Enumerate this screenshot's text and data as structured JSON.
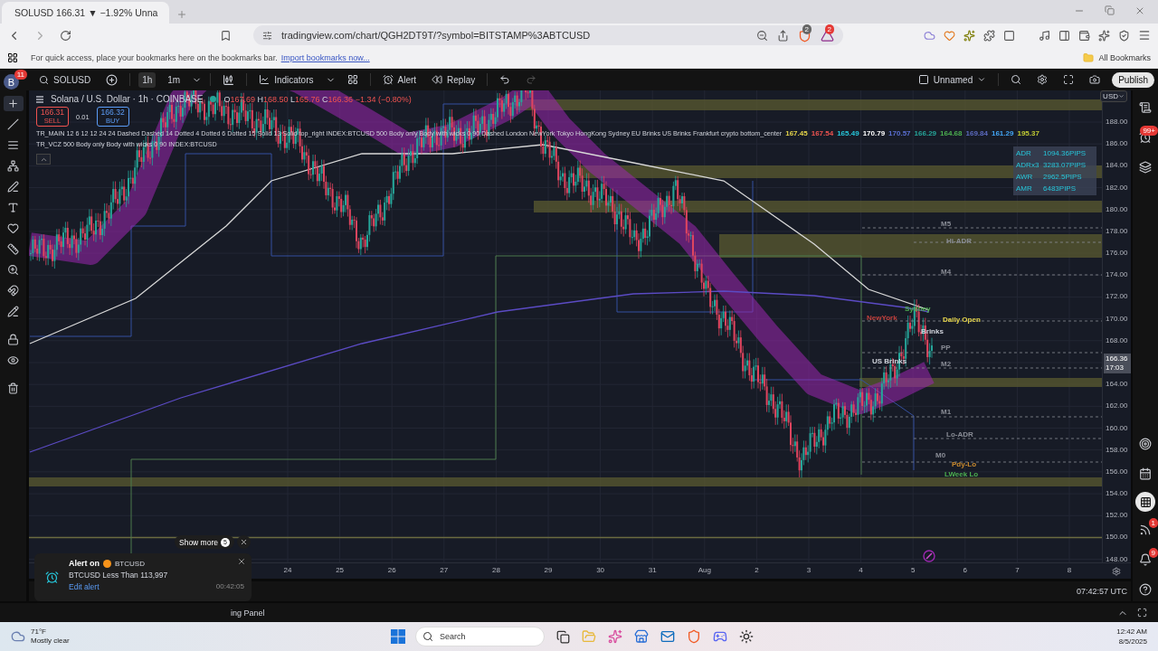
{
  "browser": {
    "tab_title": "SOLUSD 166.31 ▼ −1.92% Unna",
    "url": "tradingview.com/chart/QGH2DT9T/?symbol=BITSTAMP%3ABTCUSD",
    "extension_badges": [
      "2",
      "2"
    ],
    "bookmarks_hint": "For quick access, place your bookmarks here on the bookmarks bar.",
    "import_link": "Import bookmarks now...",
    "all_bookmarks": "All Bookmarks"
  },
  "toolbar": {
    "avatar": "B",
    "avatar_badge": "11",
    "symbol": "SOLUSD",
    "intervals": [
      {
        "label": "1h",
        "selected": true
      },
      {
        "label": "1m",
        "selected": false
      }
    ],
    "indicators": "Indicators",
    "alert": "Alert",
    "replay": "Replay",
    "layout_name": "Unnamed",
    "publish": "Publish"
  },
  "chart": {
    "title": "Solana / U.S. Dollar · 1h · COINBASE",
    "ohlc": [
      {
        "label": "O",
        "value": "167.69"
      },
      {
        "label": "H",
        "value": "168.50"
      },
      {
        "label": "L",
        "value": "165.76"
      },
      {
        "label": "C",
        "value": "166.36"
      }
    ],
    "change": "−1.34 (−0.80%)",
    "sell": {
      "price": "166.31",
      "label": "SELL"
    },
    "spread": "0.01",
    "buy": {
      "price": "166.32",
      "label": "BUY"
    },
    "indicator_lines": [
      {
        "text": "TR_MAIN 12 6 12 12 24 24 Dashed Dashed 14 Dotted 4 Dotted 6 Dotted 15 Solid 13 Solid top_right INDEX:BTCUSD 500 Body only Body with wicks 0 90 Dashed London NewYork Tokyo HongKong Sydney EU Brinks US Brinks Frankfurt crypto bottom_center",
        "values": [
          {
            "text": "167.45",
            "color": "#e6d54a"
          },
          {
            "text": "167.54",
            "color": "#ef5350"
          },
          {
            "text": "165.49",
            "color": "#26c6da"
          },
          {
            "text": "170.79",
            "color": "#ffffff"
          },
          {
            "text": "170.57",
            "color": "#5a6fd0"
          },
          {
            "text": "166.29",
            "color": "#26a69a"
          },
          {
            "text": "164.68",
            "color": "#4caf50"
          },
          {
            "text": "169.84",
            "color": "#5c6bc0"
          },
          {
            "text": "161.29",
            "color": "#42a5f5"
          },
          {
            "text": "195.37",
            "color": "#c0ca33"
          }
        ]
      },
      {
        "text": "TR_VCZ 500 Body only Body with wicks 0 90 INDEX:BTCUSD"
      }
    ],
    "adr_table": [
      {
        "label": "ADR",
        "value": "1094.36PIPS"
      },
      {
        "label": "ADRx3",
        "value": "3283.07PIPS"
      },
      {
        "label": "AWR",
        "value": "2962.5PIPS"
      },
      {
        "label": "AMR",
        "value": "6483PIPS"
      }
    ],
    "levels": [
      {
        "label": "M5",
        "color": "#8a8d96"
      },
      {
        "label": "Hi-ADR",
        "color": "#8a8d96"
      },
      {
        "label": "M4",
        "color": "#8a8d96"
      },
      {
        "label": "NewYork",
        "color": "#c2403d"
      },
      {
        "label": "Sydney",
        "color": "#4caf50"
      },
      {
        "label": "Daily Open",
        "color": "#e6d54a"
      },
      {
        "label": "Brinks",
        "color": "#d1d4dc"
      },
      {
        "label": "PP",
        "color": "#8a8d96"
      },
      {
        "label": "US Brinks",
        "color": "#d1d4dc"
      },
      {
        "label": "M2",
        "color": "#8a8d96"
      },
      {
        "label": "M1",
        "color": "#8a8d96"
      },
      {
        "label": "Lo-ADR",
        "color": "#8a8d96"
      },
      {
        "label": "M0",
        "color": "#8a8d96"
      },
      {
        "label": "Pdy-Lo",
        "color": "#c98a2e"
      },
      {
        "label": "LWeek Lo",
        "color": "#4caf50"
      }
    ]
  },
  "price_axis": {
    "currency": "USD",
    "labels": [
      "188.00",
      "186.00",
      "184.00",
      "182.00",
      "180.00",
      "178.00",
      "176.00",
      "174.00",
      "172.00",
      "170.00",
      "168.00",
      "164.00",
      "162.00",
      "160.00",
      "158.00",
      "156.00",
      "154.00",
      "152.00",
      "150.00",
      "148.00"
    ],
    "last_price": "166.36",
    "countdown": "17:03"
  },
  "time_axis": [
    "24",
    "25",
    "26",
    "27",
    "28",
    "29",
    "30",
    "31",
    "Aug",
    "2",
    "3",
    "4",
    "5",
    "6",
    "7",
    "8"
  ],
  "clock": "07:42:57 UTC",
  "sidebar_badges": {
    "alerts": "99+",
    "feed": "1",
    "notifications": "9"
  },
  "alert_popup": {
    "show_more": "Show more",
    "count": "5",
    "title": "Alert on",
    "symbol": "BTCUSD",
    "message": "BTCUSD Less Than 113,997",
    "edit_link": "Edit alert",
    "time": "00:42:05"
  },
  "bottom_panel": {
    "label": "ing Panel"
  },
  "taskbar": {
    "temperature": "71°F",
    "weather": "Mostly clear",
    "search_placeholder": "Search",
    "time": "12:42 AM",
    "date": "8/5/2025"
  }
}
